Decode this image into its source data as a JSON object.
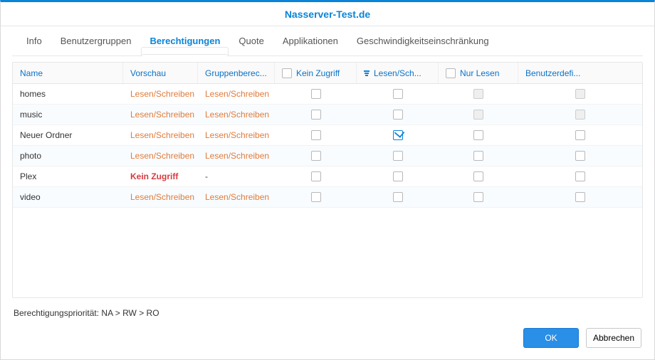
{
  "title": "Nasserver-Test.de",
  "tabs": {
    "info": "Info",
    "groups": "Benutzergruppen",
    "perms": "Berechtigungen",
    "quota": "Quote",
    "apps": "Applikationen",
    "speed": "Geschwindigkeitseinschränkung"
  },
  "columns": {
    "name": "Name",
    "preview": "Vorschau",
    "groupperm": "Gruppenberec...",
    "noaccess": "Kein Zugriff",
    "readwrite": "Lesen/Sch...",
    "readonly": "Nur Lesen",
    "custom": "Benutzerdefi..."
  },
  "rows": [
    {
      "name": "homes",
      "preview": "Lesen/Schreiben",
      "preview_cls": "rw",
      "group": "Lesen/Schreiben",
      "group_cls": "rw",
      "rw_checked": false,
      "ro_disabled": true,
      "custom_disabled": true
    },
    {
      "name": "music",
      "preview": "Lesen/Schreiben",
      "preview_cls": "rw",
      "group": "Lesen/Schreiben",
      "group_cls": "rw",
      "rw_checked": false,
      "ro_disabled": true,
      "custom_disabled": true
    },
    {
      "name": "Neuer Ordner",
      "preview": "Lesen/Schreiben",
      "preview_cls": "rw",
      "group": "Lesen/Schreiben",
      "group_cls": "rw",
      "rw_checked": true,
      "ro_disabled": false,
      "custom_disabled": false
    },
    {
      "name": "photo",
      "preview": "Lesen/Schreiben",
      "preview_cls": "rw",
      "group": "Lesen/Schreiben",
      "group_cls": "rw",
      "rw_checked": false,
      "ro_disabled": false,
      "custom_disabled": false
    },
    {
      "name": "Plex",
      "preview": "Kein Zugriff",
      "preview_cls": "na",
      "group": "-",
      "group_cls": "",
      "rw_checked": false,
      "ro_disabled": false,
      "custom_disabled": false
    },
    {
      "name": "video",
      "preview": "Lesen/Schreiben",
      "preview_cls": "rw",
      "group": "Lesen/Schreiben",
      "group_cls": "rw",
      "rw_checked": false,
      "ro_disabled": false,
      "custom_disabled": false
    }
  ],
  "priority_label": "Berechtigungspriorität: NA > RW > RO",
  "buttons": {
    "ok": "OK",
    "cancel": "Abbrechen"
  }
}
